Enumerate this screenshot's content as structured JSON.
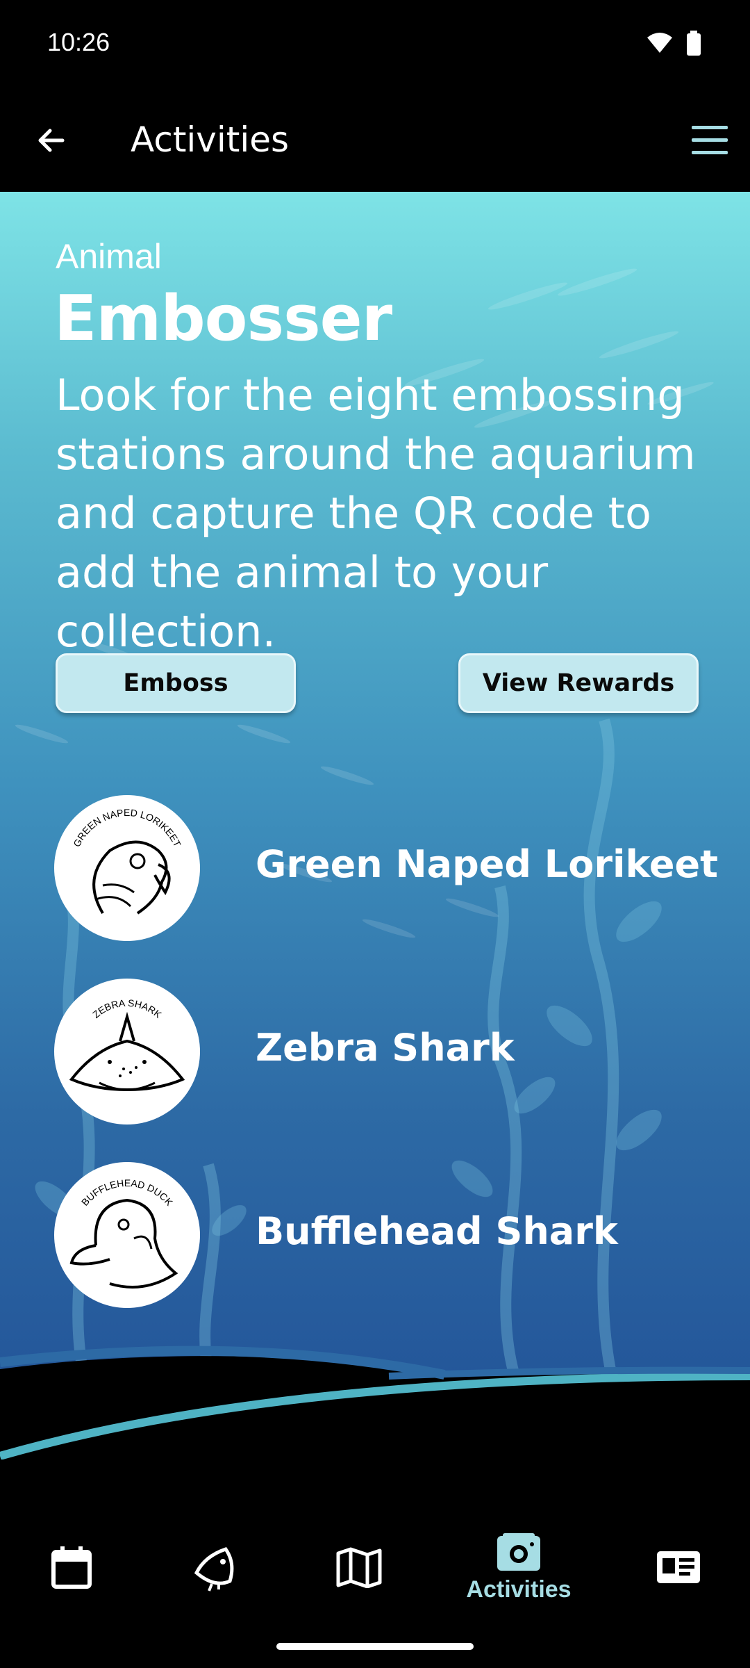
{
  "status": {
    "time": "10:26"
  },
  "header": {
    "title": "Activities"
  },
  "intro": {
    "subtitle": "Animal",
    "title": "Embosser",
    "description": "Look for the eight embossing stations around the aquarium and capture the QR code to add the animal to your collection."
  },
  "buttons": {
    "emboss": "Emboss",
    "view_rewards": "View Rewards"
  },
  "animals": [
    {
      "name": "Green Naped Lorikeet",
      "badge_text": "GREEN NAPED LORIKEET"
    },
    {
      "name": "Zebra Shark",
      "badge_text": "ZEBRA SHARK"
    },
    {
      "name": "Bufflehead Shark",
      "badge_text": "BUFFLEHEAD DUCK"
    }
  ],
  "bottom_nav": {
    "items": [
      "calendar-icon",
      "fish-icon",
      "map-icon",
      "camera-icon",
      "id-card-icon"
    ],
    "active_label": "Activities"
  },
  "colors": {
    "accent": "#a6dde4",
    "button_bg": "#c2e8ef",
    "wave_teal": "#4fb3c4"
  }
}
